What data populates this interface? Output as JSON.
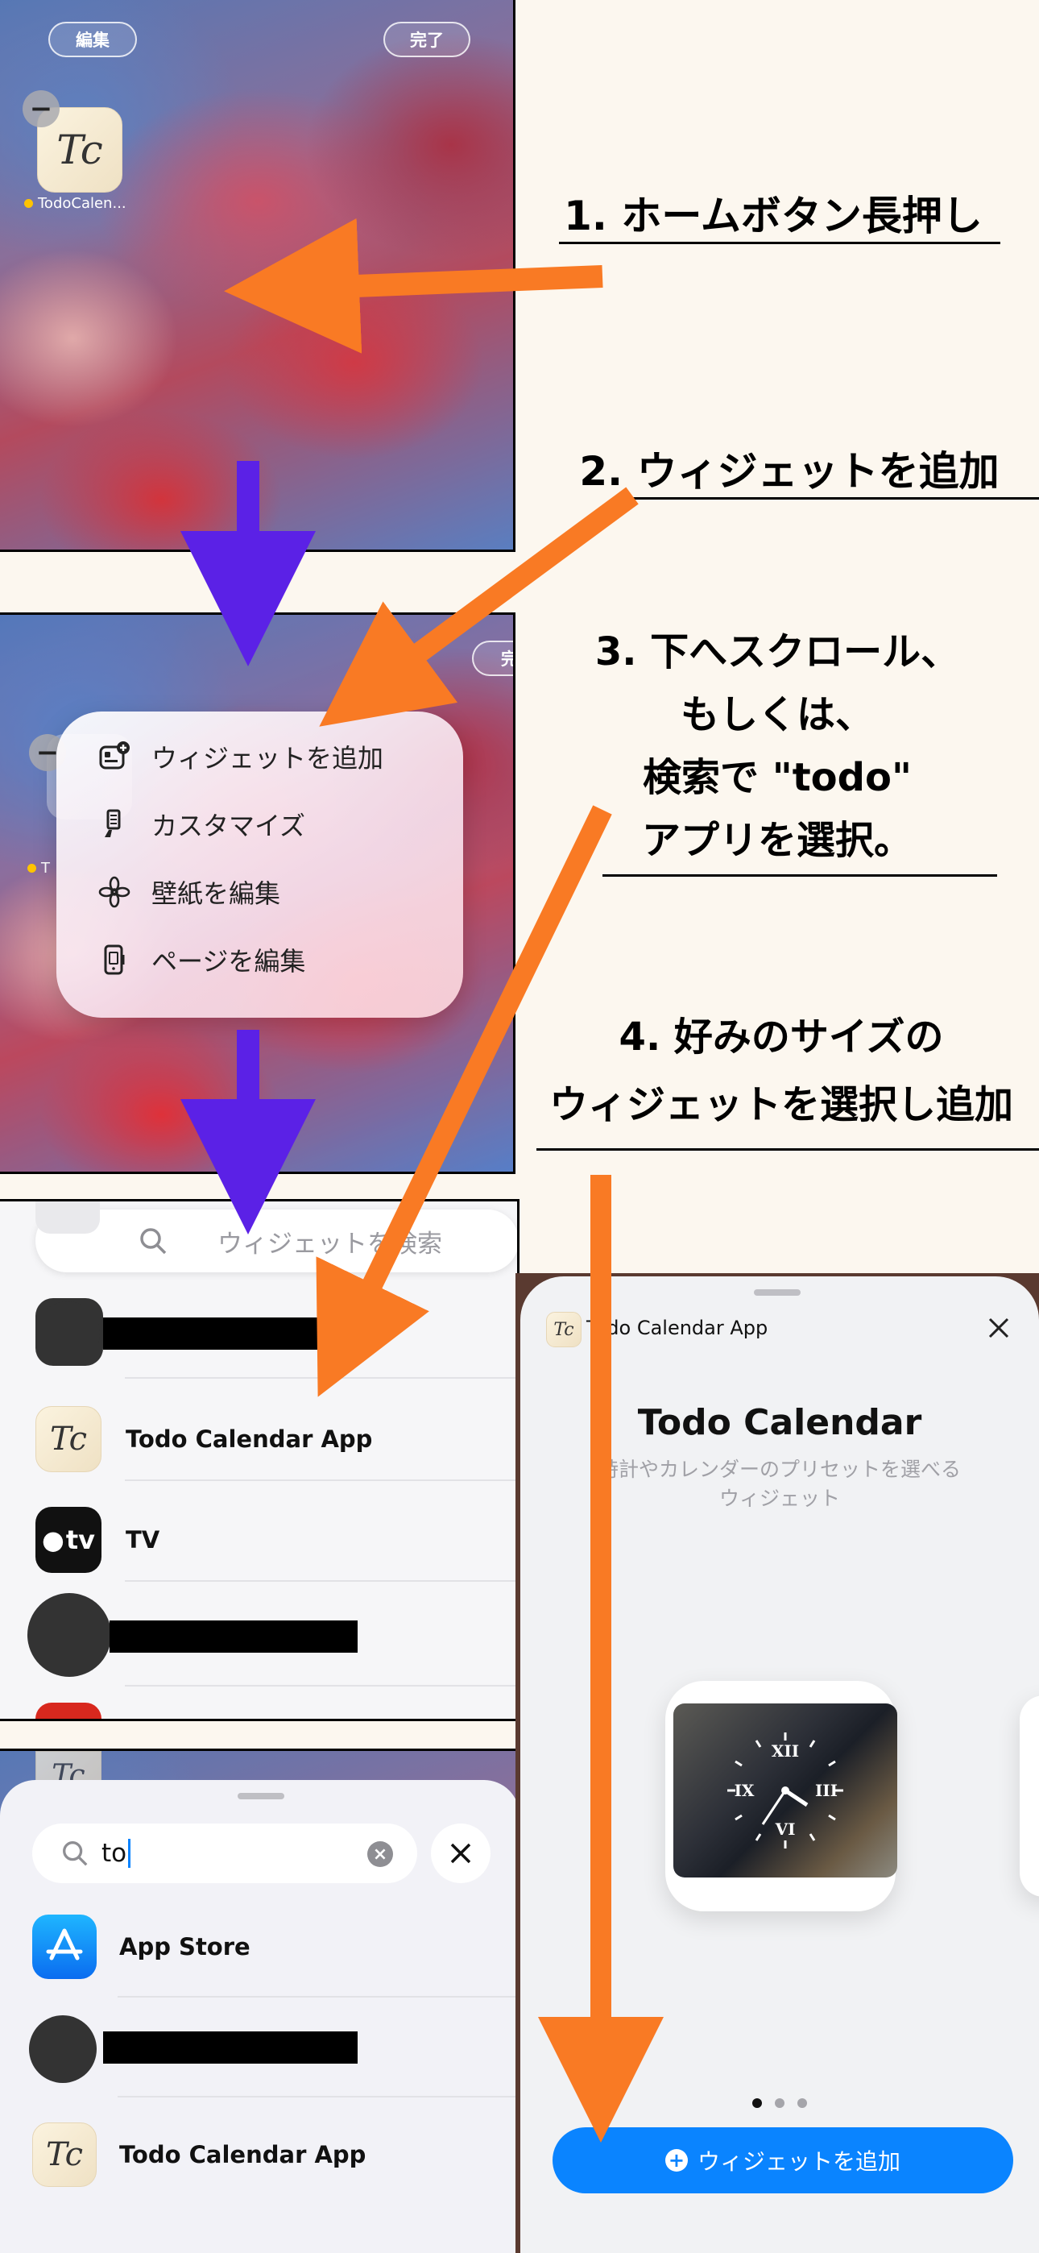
{
  "panel1": {
    "edit_label": "編集",
    "done_label": "完了",
    "app_icon_text": "Tc",
    "app_name": "TodoCalen..."
  },
  "panel2": {
    "done_partial": "完",
    "app_name_partial": "T",
    "menu": [
      {
        "label": "ウィジェットを追加",
        "icon": "widget-add-icon"
      },
      {
        "label": "カスタマイズ",
        "icon": "paintbrush-icon"
      },
      {
        "label": "壁紙を編集",
        "icon": "flower-icon"
      },
      {
        "label": "ページを編集",
        "icon": "phone-icon"
      }
    ]
  },
  "panel3": {
    "search_placeholder": "ウィジェットを検索",
    "items": [
      {
        "label": "Todo Calendar App",
        "icon": "todo-calendar-app-icon"
      },
      {
        "label": "TV",
        "icon": "tv-icon",
        "icon_text": "tv"
      }
    ]
  },
  "panel4": {
    "search_value": "to",
    "results": [
      {
        "label": "App Store",
        "icon": "app-store-icon"
      },
      {
        "label": "Todo Calendar App",
        "icon": "todo-calendar-app-icon"
      }
    ]
  },
  "panel5": {
    "app_name": "Todo Calendar App",
    "title": "Todo Calendar",
    "description_line1": "時計やカレンダーのプリセットを選べる",
    "description_line2": "ウィジェット",
    "clock_numerals": [
      "XII",
      "III",
      "VI",
      "IX"
    ],
    "page_dots": 3,
    "active_dot": 0,
    "add_button_label": "ウィジェットを追加"
  },
  "annotations": {
    "step1": "1. ホームボタン長押し",
    "step2": "2. ウィジェットを追加",
    "step3_lines": [
      "3. 下へスクロール、",
      "もしくは、",
      "検索で \"todo\"",
      "アプリを選択。"
    ],
    "step4_lines": [
      "4. 好みのサイズの",
      "ウィジェットを選択し追加"
    ]
  },
  "colors": {
    "arrow_orange": "#f97a24",
    "arrow_purple": "#5b21e6",
    "ios_blue": "#0a84ff",
    "background": "#fcf7ef"
  }
}
